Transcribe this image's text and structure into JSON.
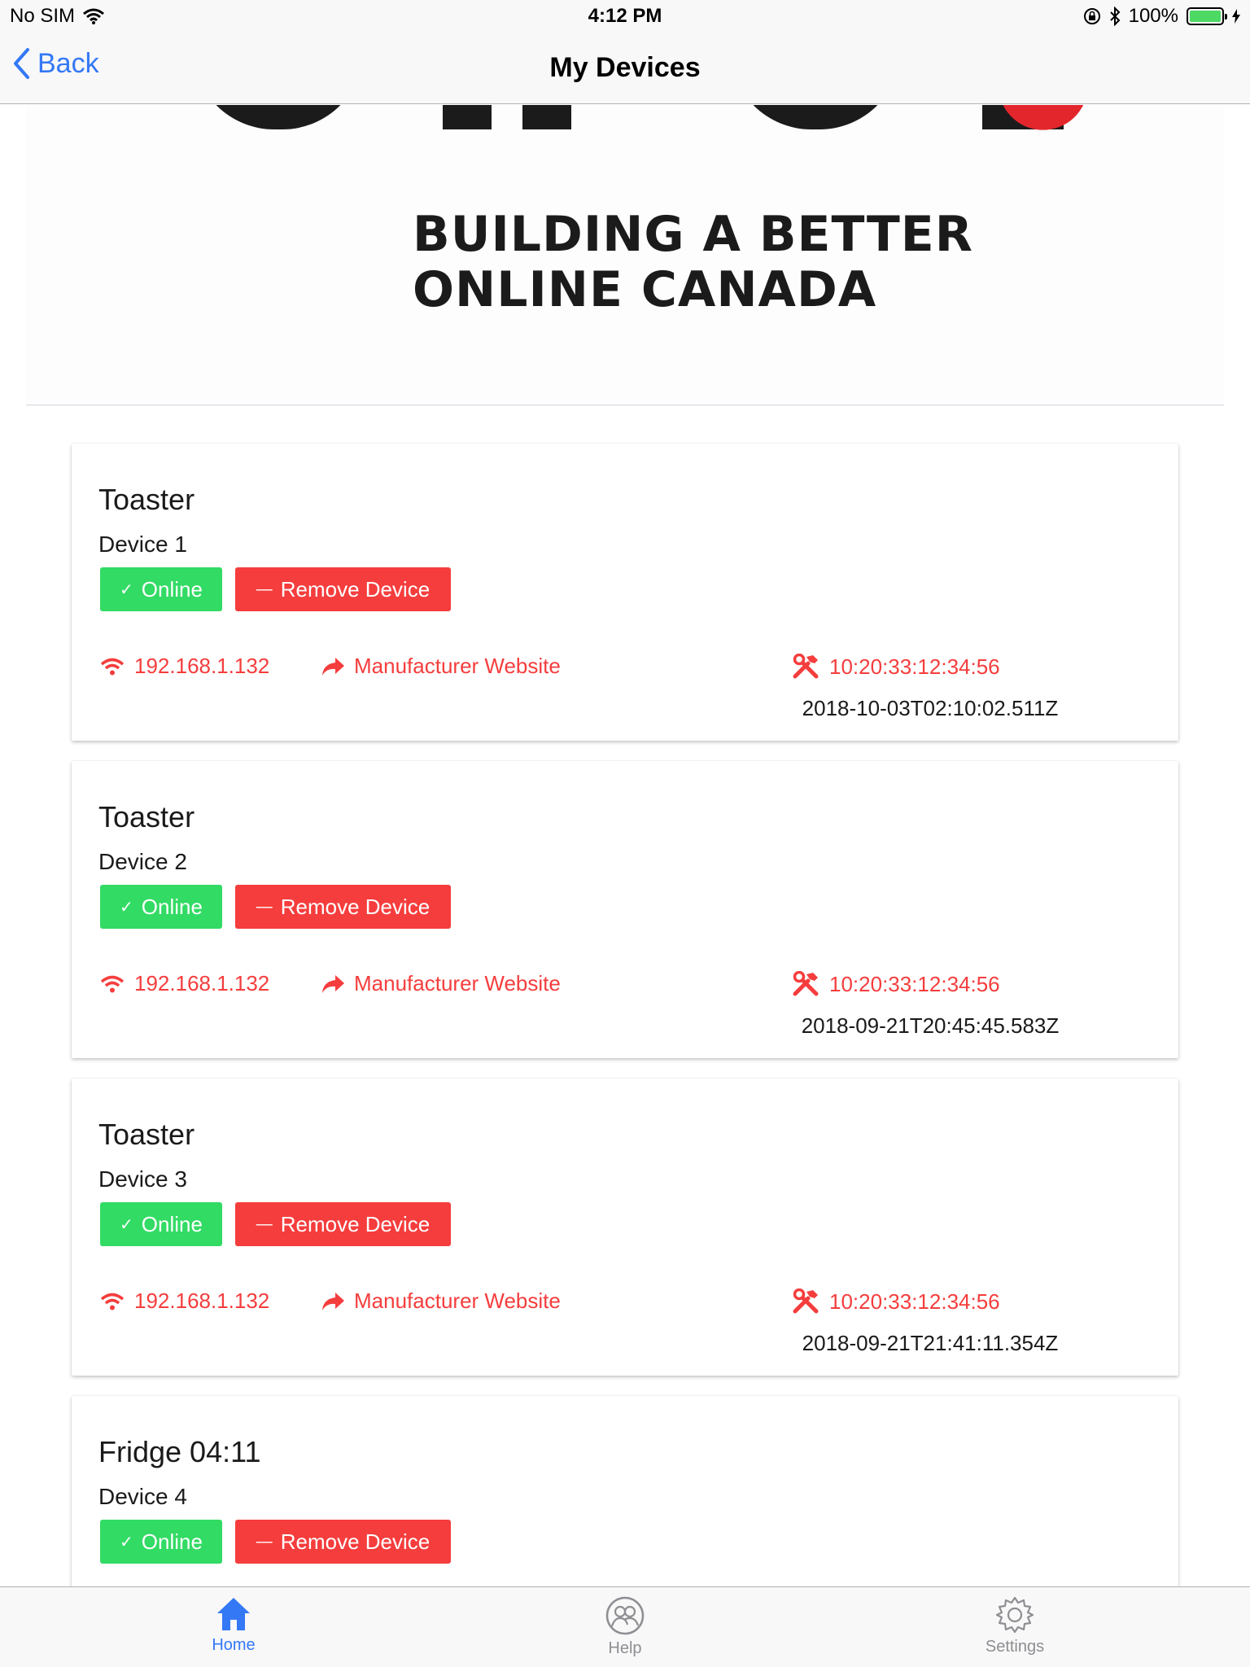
{
  "status_bar": {
    "carrier": "No SIM",
    "time": "4:12 PM",
    "battery": "100%",
    "battery_level": 1.0
  },
  "nav": {
    "back_label": "Back",
    "title": "My Devices"
  },
  "banner": {
    "tagline_line1": "BUILDING A BETTER",
    "tagline_line2": "ONLINE CANADA"
  },
  "devices": [
    {
      "name": "Toaster",
      "label": "Device 1",
      "status_label": "Online",
      "remove_label": "Remove Device",
      "ip": "192.168.1.132",
      "website_label": "Manufacturer Website",
      "mac": "10:20:33:12:34:56",
      "timestamp": "2018-10-03T02:10:02.511Z"
    },
    {
      "name": "Toaster",
      "label": "Device 2",
      "status_label": "Online",
      "remove_label": "Remove Device",
      "ip": "192.168.1.132",
      "website_label": "Manufacturer Website",
      "mac": "10:20:33:12:34:56",
      "timestamp": "2018-09-21T20:45:45.583Z"
    },
    {
      "name": "Toaster",
      "label": "Device 3",
      "status_label": "Online",
      "remove_label": "Remove Device",
      "ip": "192.168.1.132",
      "website_label": "Manufacturer Website",
      "mac": "10:20:33:12:34:56",
      "timestamp": "2018-09-21T21:41:11.354Z"
    },
    {
      "name": "Fridge 04:11",
      "label": "Device 4",
      "status_label": "Online",
      "remove_label": "Remove Device"
    }
  ],
  "tabs": [
    {
      "label": "Home",
      "icon": "home-icon",
      "active": true
    },
    {
      "label": "Help",
      "icon": "help-icon",
      "active": false
    },
    {
      "label": "Settings",
      "icon": "gear-icon",
      "active": false
    }
  ],
  "colors": {
    "accent": "#3478f6",
    "online": "#32db64",
    "danger": "#f53d3d"
  }
}
